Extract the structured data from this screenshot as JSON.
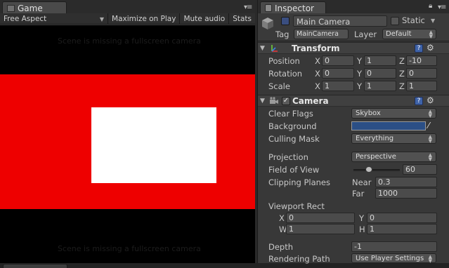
{
  "game": {
    "tab_title": "Game",
    "toolbar": {
      "aspect": "Free Aspect",
      "maximize": "Maximize on Play",
      "mute": "Mute audio",
      "stats": "Stats"
    },
    "ghost_text_top": "Scene is missing a fullscreen camera",
    "ghost_text_bottom": "Scene is missing a fullscreen camera",
    "colors": {
      "red_band": "#ee0000",
      "white_rect": "#ffffff",
      "background": "#000000"
    }
  },
  "inspector": {
    "tab_title": "Inspector",
    "object": {
      "name": "Main Camera",
      "static_label": "Static",
      "tag_label": "Tag",
      "tag_value": "MainCamera",
      "layer_label": "Layer",
      "layer_value": "Default"
    },
    "transform": {
      "title": "Transform",
      "position_label": "Position",
      "rotation_label": "Rotation",
      "scale_label": "Scale",
      "position": {
        "x": "0",
        "y": "1",
        "z": "-10"
      },
      "rotation": {
        "x": "0",
        "y": "0",
        "z": "0"
      },
      "scale": {
        "x": "1",
        "y": "1",
        "z": "1"
      }
    },
    "camera": {
      "title": "Camera",
      "clear_flags_label": "Clear Flags",
      "clear_flags": "Skybox",
      "background_label": "Background",
      "background_color": "#2b4f86",
      "culling_mask_label": "Culling Mask",
      "culling_mask": "Everything",
      "projection_label": "Projection",
      "projection": "Perspective",
      "fov_label": "Field of View",
      "fov": "60",
      "clipping_label": "Clipping Planes",
      "near_label": "Near",
      "near": "0.3",
      "far_label": "Far",
      "far": "1000",
      "viewport_label": "Viewport Rect",
      "vp_x": "0",
      "vp_y": "0",
      "vp_w": "1",
      "vp_h": "1",
      "depth_label": "Depth",
      "depth": "-1",
      "rendering_path_label": "Rendering Path",
      "rendering_path": "Use Player Settings"
    }
  },
  "axes": {
    "x": "X",
    "y": "Y",
    "z": "Z",
    "w": "W",
    "h": "H"
  }
}
